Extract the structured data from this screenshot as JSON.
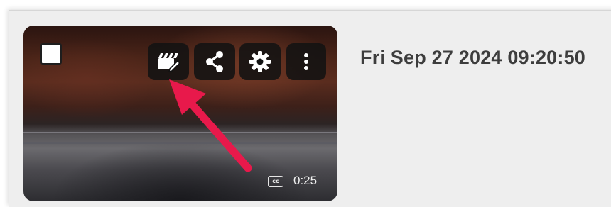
{
  "video_card": {
    "timestamp": "Fri Sep 27 2024 09:20:50",
    "duration": "0:25",
    "cc_label": "cc",
    "select_checked": false,
    "toolbar": {
      "edit_icon": "edit-video-icon",
      "share_icon": "share-icon",
      "settings_icon": "gear-icon",
      "more_icon": "more-vertical-icon"
    }
  },
  "annotation": {
    "arrow_color": "#e8194b"
  }
}
